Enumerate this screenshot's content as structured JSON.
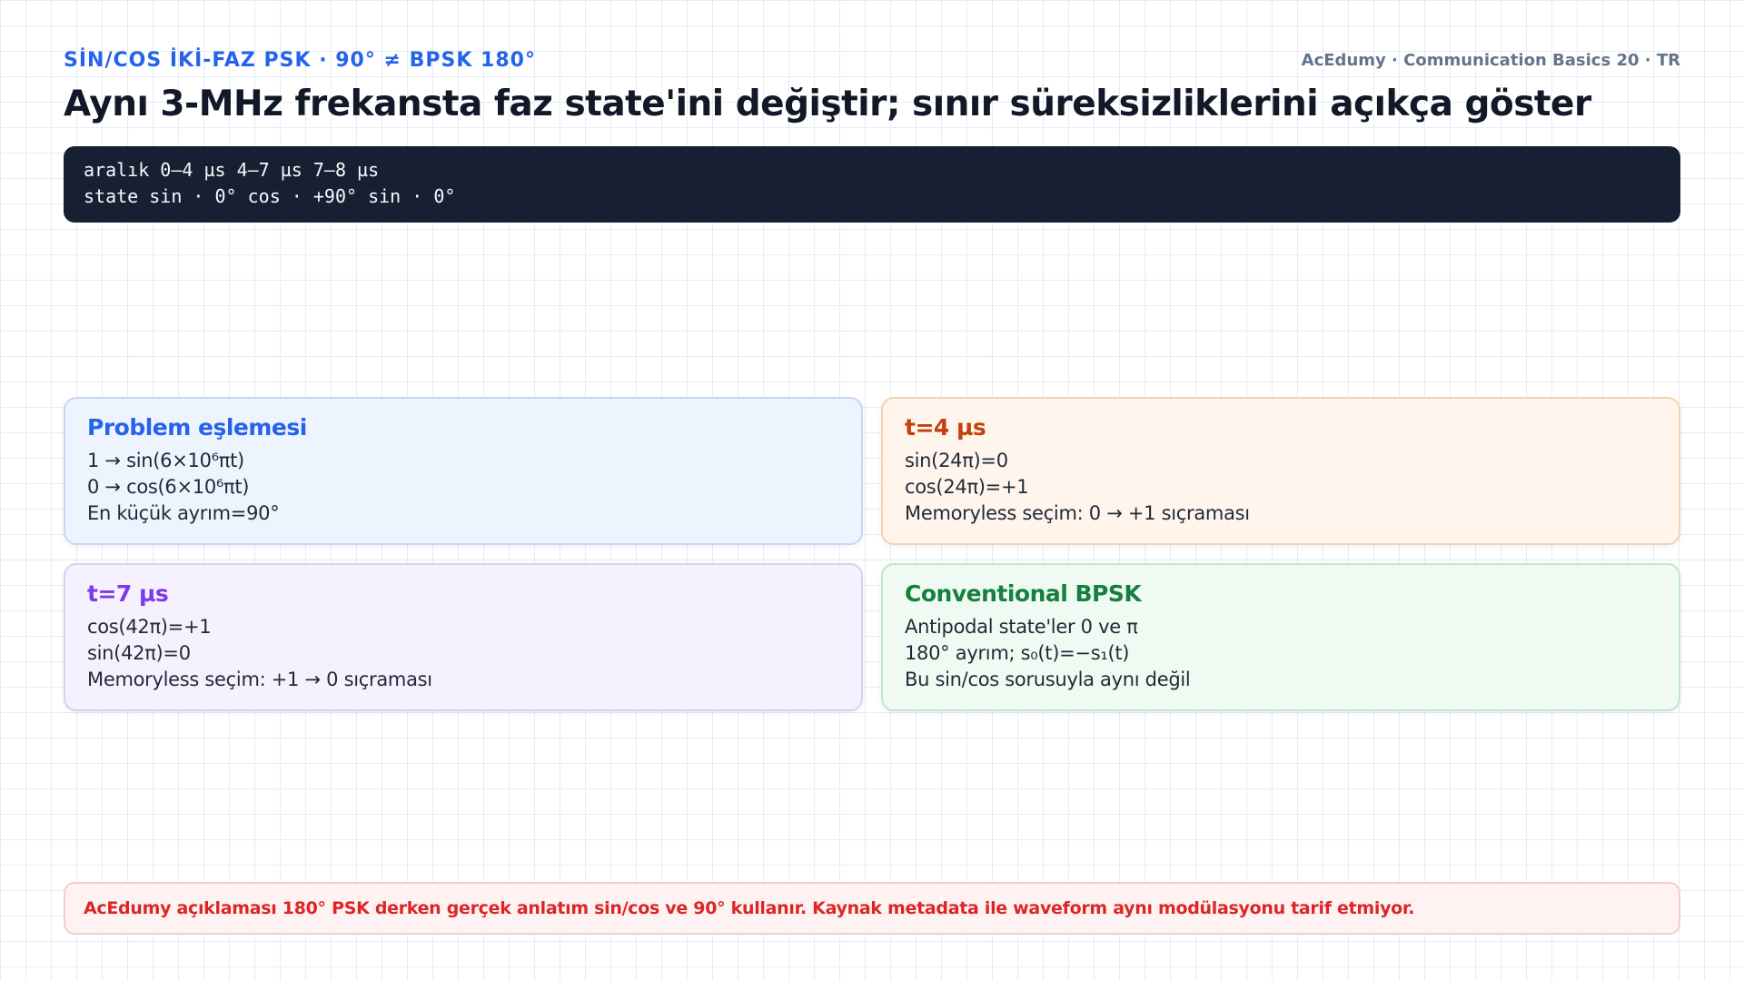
{
  "header": {
    "kicker": "SİN/COS İKİ-FAZ PSK · 90° ≠ BPSK 180°",
    "brand": "AcEdumy · Communication Basics 20 · TR",
    "title": "Aynı 3-MHz frekansta faz state'ini değiştir; sınır süreksizliklerini açıkça göster"
  },
  "code": {
    "line1": "aralık 0–4 µs 4–7 µs 7–8 µs",
    "line2": "state sin · 0° cos · +90° sin · 0°"
  },
  "cards": [
    {
      "title": "Problem eşlemesi",
      "lines": [
        "1 → sin(6×10⁶πt)",
        "0 → cos(6×10⁶πt)",
        "En küçük ayrım=90°"
      ]
    },
    {
      "title": "t=4 µs",
      "lines": [
        "sin(24π)=0",
        "cos(24π)=+1",
        "Memoryless seçim: 0 → +1 sıçraması"
      ]
    },
    {
      "title": "t=7 µs",
      "lines": [
        "cos(42π)=+1",
        "sin(42π)=0",
        "Memoryless seçim: +1 → 0 sıçraması"
      ]
    },
    {
      "title": "Conventional BPSK",
      "lines": [
        "Antipodal state'ler 0 ve π",
        "180° ayrım; s₀(t)=−s₁(t)",
        "Bu sin/cos sorusuyla aynı değil"
      ]
    }
  ],
  "warning": "AcEdumy açıklaması 180° PSK derken gerçek anlatım sin/cos ve 90° kullanır. Kaynak metadata ile waveform aynı modülasyonu tarif etmiyor.",
  "colors": {
    "accent_blue": "#2563eb",
    "accent_orange": "#c2410c",
    "accent_purple": "#7c3aed",
    "accent_green": "#15803d",
    "warning_red": "#dc2626",
    "code_bg": "#172033"
  }
}
